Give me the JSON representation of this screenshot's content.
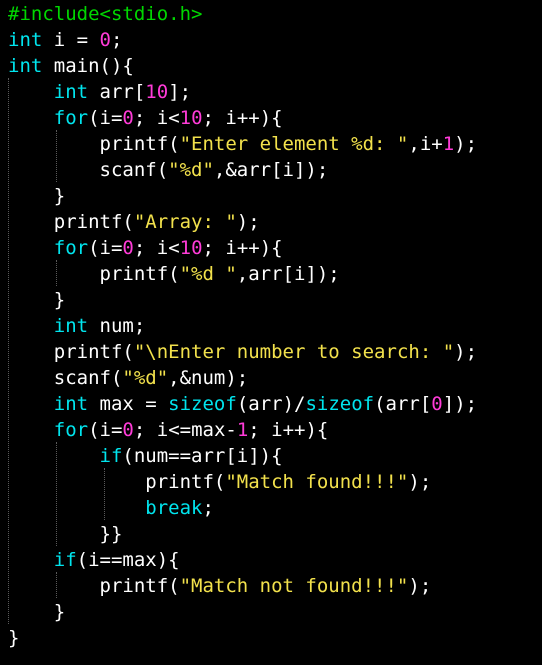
{
  "theme": {
    "background": "#000000",
    "plain": "#ffffff",
    "preprocessor": "#00d700",
    "keyword": "#00e5ee",
    "number": "#ff3bd8",
    "string": "#f2e14c",
    "indent_guide": "#5a5a5a"
  },
  "code": {
    "lines": [
      [
        [
          "pre",
          "#include<stdio.h>"
        ]
      ],
      [
        [
          "kw",
          "int"
        ],
        [
          "op",
          " i = "
        ],
        [
          "num",
          "0"
        ],
        [
          "op",
          ";"
        ]
      ],
      [
        [
          "kw",
          "int"
        ],
        [
          "op",
          " main(){"
        ]
      ],
      [
        [
          "op",
          "    "
        ],
        [
          "kw",
          "int"
        ],
        [
          "op",
          " arr["
        ],
        [
          "num",
          "10"
        ],
        [
          "op",
          "];"
        ]
      ],
      [
        [
          "op",
          "    "
        ],
        [
          "kw",
          "for"
        ],
        [
          "op",
          "(i="
        ],
        [
          "num",
          "0"
        ],
        [
          "op",
          "; i<"
        ],
        [
          "num",
          "10"
        ],
        [
          "op",
          "; i++){"
        ]
      ],
      [
        [
          "op",
          "        printf("
        ],
        [
          "str",
          "\"Enter element %d: \""
        ],
        [
          "op",
          ",i+"
        ],
        [
          "num",
          "1"
        ],
        [
          "op",
          ");"
        ]
      ],
      [
        [
          "op",
          "        scanf("
        ],
        [
          "str",
          "\"%d\""
        ],
        [
          "op",
          ",&arr[i]);"
        ]
      ],
      [
        [
          "op",
          "    }"
        ]
      ],
      [
        [
          "op",
          "    printf("
        ],
        [
          "str",
          "\"Array: \""
        ],
        [
          "op",
          ");"
        ]
      ],
      [
        [
          "op",
          "    "
        ],
        [
          "kw",
          "for"
        ],
        [
          "op",
          "(i="
        ],
        [
          "num",
          "0"
        ],
        [
          "op",
          "; i<"
        ],
        [
          "num",
          "10"
        ],
        [
          "op",
          "; i++){"
        ]
      ],
      [
        [
          "op",
          "        printf("
        ],
        [
          "str",
          "\"%d \""
        ],
        [
          "op",
          ",arr[i]);"
        ]
      ],
      [
        [
          "op",
          "    }"
        ]
      ],
      [
        [
          "op",
          "    "
        ],
        [
          "kw",
          "int"
        ],
        [
          "op",
          " num;"
        ]
      ],
      [
        [
          "op",
          "    printf("
        ],
        [
          "str",
          "\"\\nEnter number to search: \""
        ],
        [
          "op",
          ");"
        ]
      ],
      [
        [
          "op",
          "    scanf("
        ],
        [
          "str",
          "\"%d\""
        ],
        [
          "op",
          ",&num);"
        ]
      ],
      [
        [
          "op",
          "    "
        ],
        [
          "kw",
          "int"
        ],
        [
          "op",
          " max = "
        ],
        [
          "kw",
          "sizeof"
        ],
        [
          "op",
          "(arr)/"
        ],
        [
          "kw",
          "sizeof"
        ],
        [
          "op",
          "(arr["
        ],
        [
          "num",
          "0"
        ],
        [
          "op",
          "]);"
        ]
      ],
      [
        [
          "op",
          "    "
        ],
        [
          "kw",
          "for"
        ],
        [
          "op",
          "(i="
        ],
        [
          "num",
          "0"
        ],
        [
          "op",
          "; i<=max-"
        ],
        [
          "num",
          "1"
        ],
        [
          "op",
          "; i++){"
        ]
      ],
      [
        [
          "op",
          "        "
        ],
        [
          "kw",
          "if"
        ],
        [
          "op",
          "(num==arr[i]){"
        ]
      ],
      [
        [
          "op",
          "            printf("
        ],
        [
          "str",
          "\"Match found!!!\""
        ],
        [
          "op",
          ");"
        ]
      ],
      [
        [
          "op",
          "            "
        ],
        [
          "kw",
          "break"
        ],
        [
          "op",
          ";"
        ]
      ],
      [
        [
          "op",
          "        }}"
        ]
      ],
      [
        [
          "op",
          "    "
        ],
        [
          "kw",
          "if"
        ],
        [
          "op",
          "(i==max){"
        ]
      ],
      [
        [
          "op",
          "        printf("
        ],
        [
          "str",
          "\"Match not found!!!\""
        ],
        [
          "op",
          ");"
        ]
      ],
      [
        [
          "op",
          "    }"
        ]
      ],
      [
        [
          "op",
          "}"
        ]
      ]
    ]
  }
}
